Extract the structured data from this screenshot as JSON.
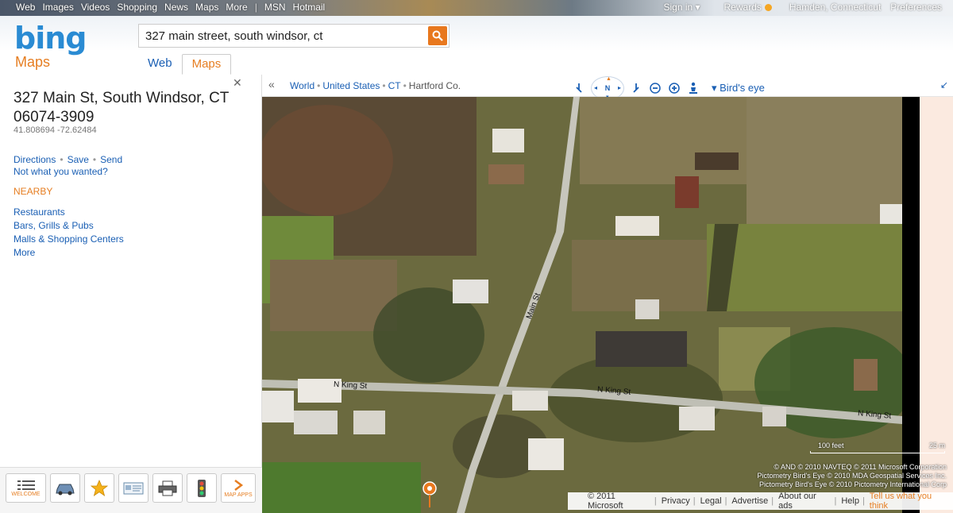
{
  "topnav": {
    "links": [
      "Web",
      "Images",
      "Videos",
      "Shopping",
      "News",
      "Maps",
      "More"
    ],
    "sep": "|",
    "msn": "MSN",
    "hotmail": "Hotmail",
    "signin": "Sign in ▾",
    "rewards": "Rewards",
    "location": "Hamden, Connecticut",
    "preferences": "Preferences"
  },
  "header": {
    "logo": "bing",
    "section": "Maps",
    "search_value": "327 main street, south windsor, ct",
    "tabs": [
      "Web",
      "Maps"
    ],
    "active_tab": "Maps"
  },
  "result": {
    "address_line1": "327 Main St, South Windsor, CT",
    "address_line2": "06074-3909",
    "coords": "41.808694 -72.62484",
    "directions": "Directions",
    "save": "Save",
    "send": "Send",
    "not_what": "Not what you wanted?",
    "nearby_title": "NEARBY",
    "nearby": [
      "Restaurants",
      "Bars, Grills & Pubs",
      "Malls & Shopping Centers",
      "More"
    ]
  },
  "toolbar": {
    "welcome": "WELCOME",
    "map_apps": "MAP APPS"
  },
  "mapbar": {
    "breadcrumb": [
      "World",
      "United States",
      "CT",
      "Hartford Co."
    ],
    "compass_label": "N",
    "view": "Bird's eye"
  },
  "map": {
    "streets": [
      "Main St",
      "N King St",
      "N King St",
      "N King St"
    ],
    "scale_left": "100 feet",
    "scale_right": "25 m",
    "copyright": [
      "© AND  © 2010 NAVTEQ  © 2011 Microsoft Corporation",
      "Pictometry Bird's Eye © 2010 MDA Geospatial Services Inc.",
      "Pictometry Bird's Eye © 2010 Pictometry International Corp"
    ]
  },
  "footer": {
    "links": [
      "© 2011 Microsoft",
      "Privacy",
      "Legal",
      "Advertise",
      "About our ads",
      "Help"
    ],
    "tell": "Tell us what you think"
  }
}
